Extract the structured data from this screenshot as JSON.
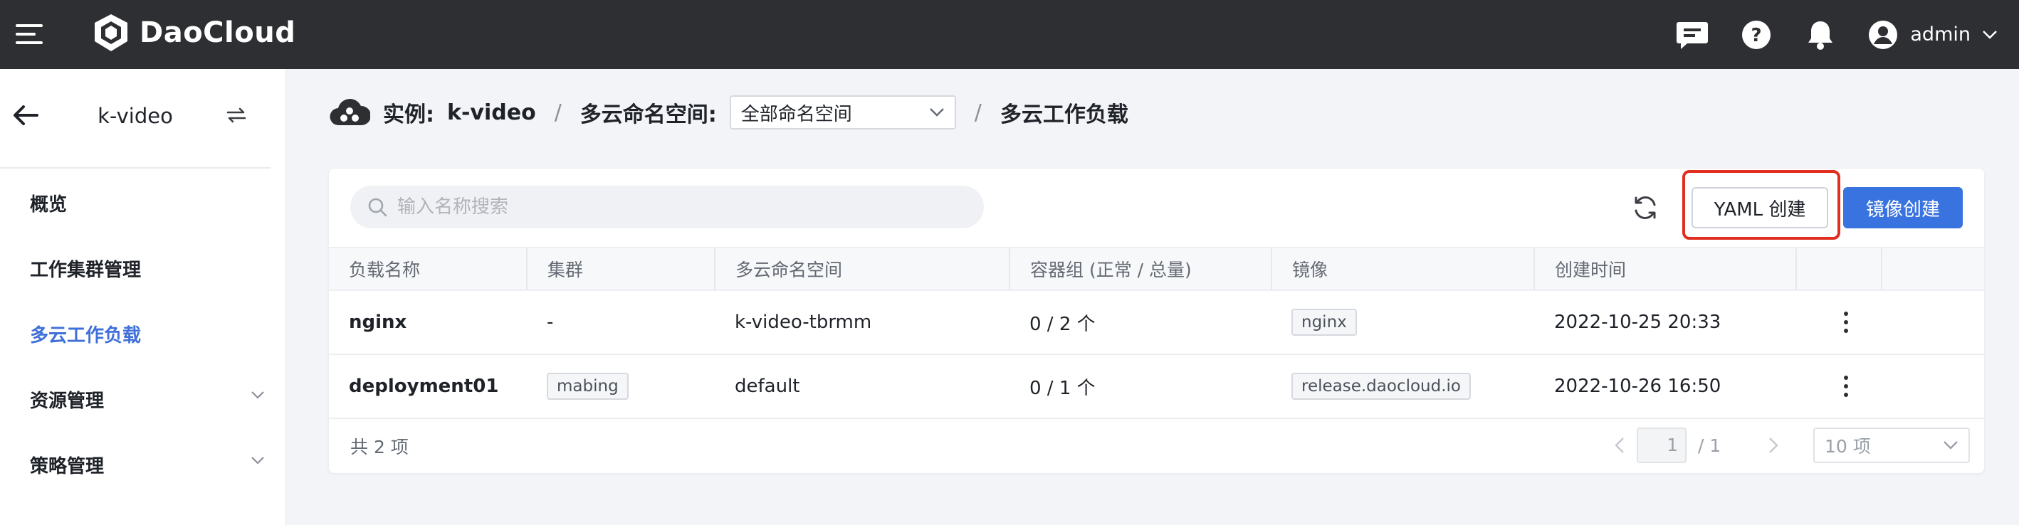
{
  "header": {
    "brand": "DaoCloud",
    "user": "admin"
  },
  "sidebar": {
    "title": "k-video",
    "items": [
      {
        "label": "概览"
      },
      {
        "label": "工作集群管理"
      },
      {
        "label": "多云工作负载",
        "active": true
      },
      {
        "label": "资源管理",
        "expandable": true
      },
      {
        "label": "策略管理",
        "expandable": true
      }
    ]
  },
  "breadcrumb": {
    "instance_label": "实例:",
    "instance_value": "k-video",
    "separator": "/",
    "namespace_label": "多云命名空间:",
    "namespace_value": "全部命名空间",
    "current": "多云工作负载"
  },
  "toolbar": {
    "search_placeholder": "输入名称搜索",
    "yaml_button": "YAML 创建",
    "image_button": "镜像创建"
  },
  "table": {
    "columns": [
      "负载名称",
      "集群",
      "多云命名空间",
      "容器组 (正常 / 总量)",
      "镜像",
      "创建时间",
      "",
      ""
    ],
    "rows": [
      {
        "name": "nginx",
        "cluster": "-",
        "namespace": "k-video-tbrmm",
        "pods": "0 / 2 个",
        "image": "nginx",
        "created": "2022-10-25 20:33"
      },
      {
        "name": "deployment01",
        "cluster": "mabing",
        "namespace": "default",
        "pods": "0 / 1 个",
        "image": "release.daocloud.io",
        "created": "2022-10-26 16:50"
      }
    ]
  },
  "pagination": {
    "total": "共 2 项",
    "page": "1",
    "of": "/ 1",
    "page_size": "10 项"
  },
  "colors": {
    "topbar": "#2e2f33",
    "accent": "#3873e0",
    "highlight": "#e02e1f"
  }
}
